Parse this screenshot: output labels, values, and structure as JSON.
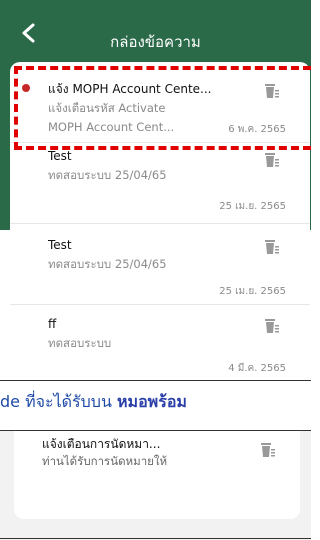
{
  "header": {
    "title": "กล่องข้อความ"
  },
  "messages": [
    {
      "title": "แจ้ง MOPH Account Cente...",
      "subtitle": "แจ้งเตือนรหัส Activate",
      "preview": "MOPH Account Cent...",
      "date": "6 พ.ค. 2565",
      "unread": true
    },
    {
      "title": "Test",
      "subtitle": "ทดสอบระบบ 25/04/65",
      "date": "25 เม.ย. 2565",
      "unread": false
    },
    {
      "title": "Test",
      "subtitle": "ทดสอบระบบ 25/04/65",
      "date": "25 เม.ย. 2565",
      "unread": false
    },
    {
      "title": "ff",
      "subtitle": "ทดสอบระบบ",
      "date": "4 มี.ค. 2565",
      "unread": false
    }
  ],
  "caption": {
    "prefix": "de ที่จะได้รับบน ",
    "bold": "หมอพร้อม"
  },
  "second_card": {
    "title": "แจ้งเตือนการนัดหมา...",
    "subtitle": "ท่านได้รับการนัดหมายให้"
  },
  "colors": {
    "header_green": "#2a6a49",
    "unread_dot": "#c62828",
    "highlight": "#e10000",
    "caption_blue": "#1f4aa8"
  },
  "icons": {
    "back": "chevron-left-icon",
    "delete": "trash-icon"
  }
}
